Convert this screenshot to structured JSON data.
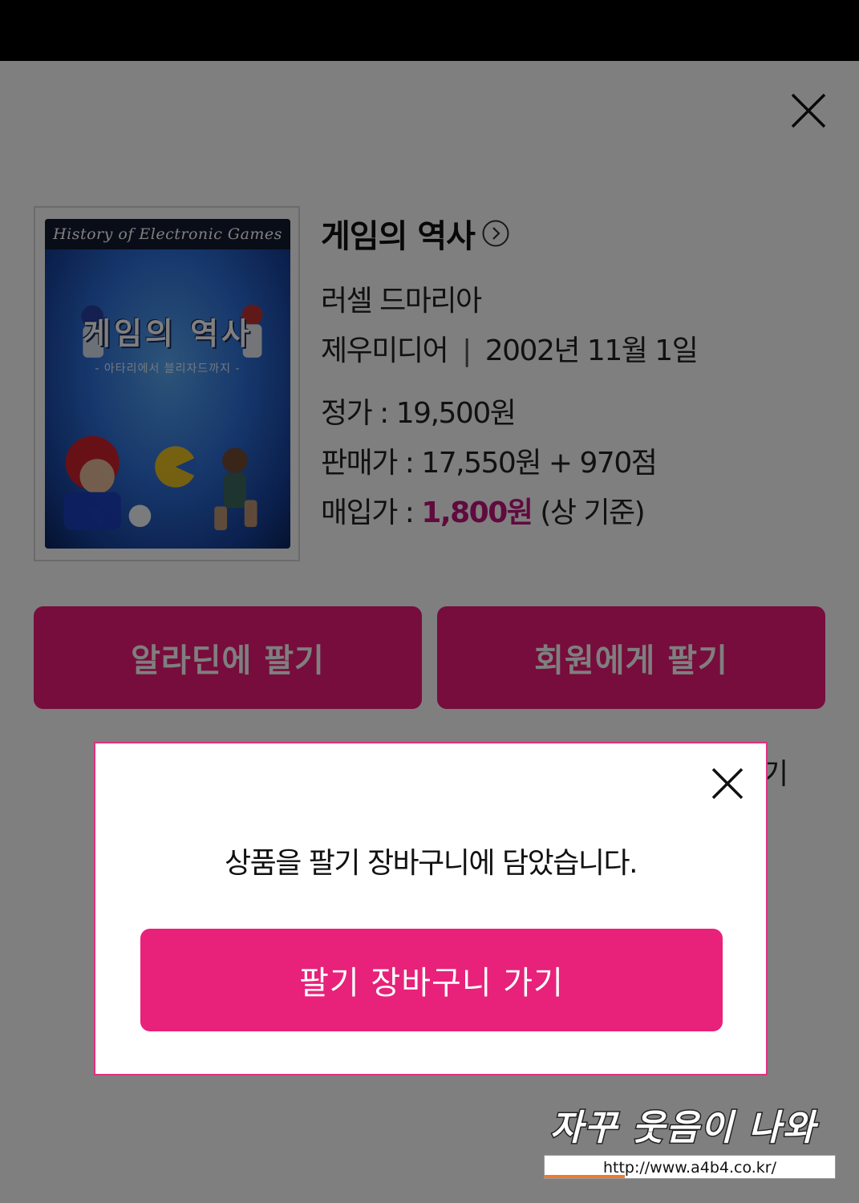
{
  "book": {
    "title": "게임의 역사",
    "author": "러셀 드마리아",
    "publisher": "제우미디어",
    "separator": "|",
    "date": "2002년 11월 1일",
    "list_price": "정가 : 19,500원",
    "sale_price": "판매가 : 17,550원 + 970점",
    "buy_label": "매입가 : ",
    "buy_value": "1,800원",
    "buy_note": " (상 기준)",
    "cover": {
      "top_text": "History of Electronic Games",
      "title": "게임의 역사",
      "subtitle": "- 아타리에서 블리자드까지 -"
    }
  },
  "actions": {
    "sell_to_aladin": "알라딘에 팔기",
    "sell_to_member": "회원에게 팔기",
    "partial": "기"
  },
  "modal": {
    "message": "상품을 팔기 장바구니에 담았습니다.",
    "button": "팔기 장바구니 가기"
  },
  "watermark": {
    "text": "자꾸 웃음이 나와~",
    "url": "http://www.a4b4.co.kr/"
  },
  "colors": {
    "accent": "#e8217a",
    "price_accent": "#c1157c"
  }
}
